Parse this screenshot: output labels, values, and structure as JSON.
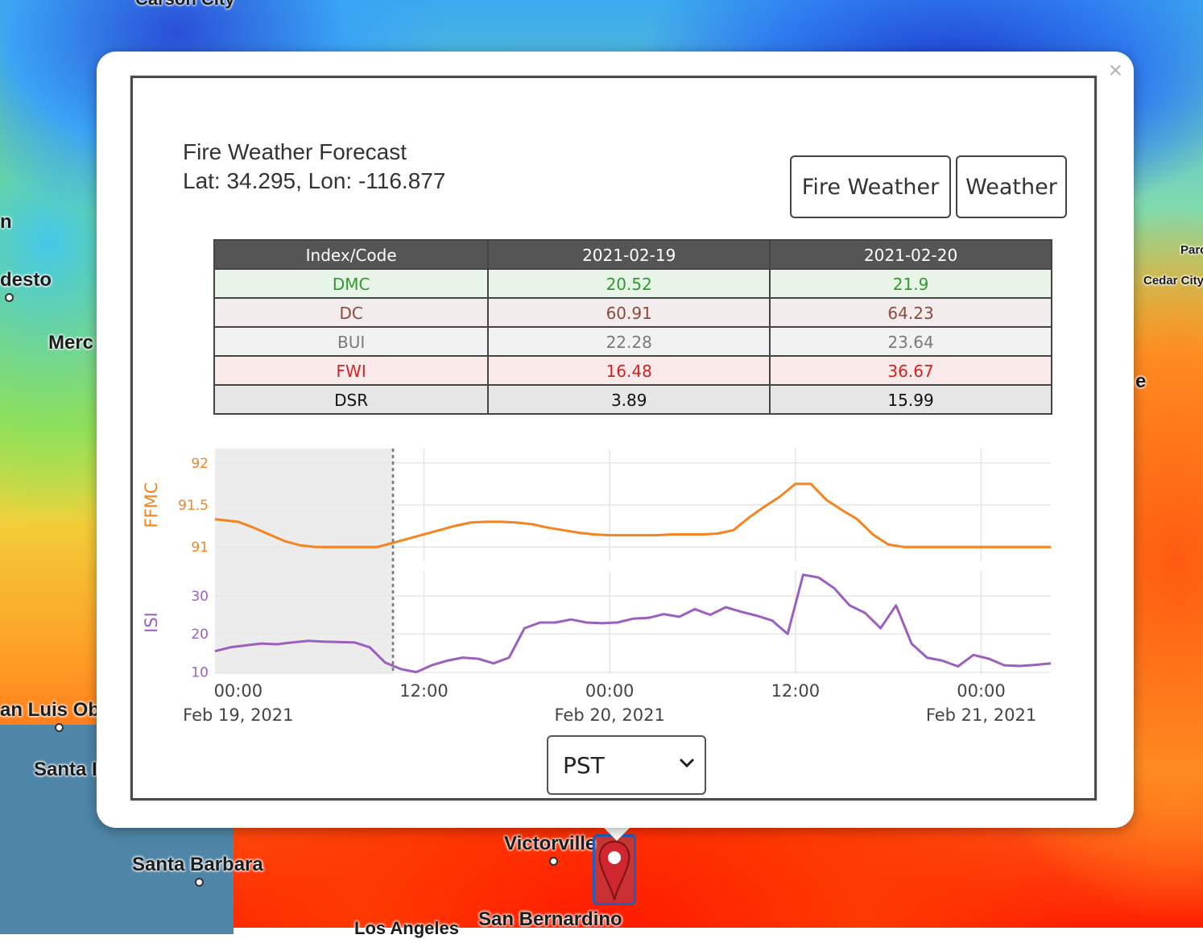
{
  "map": {
    "cities": [
      {
        "name": "Carson City"
      },
      {
        "name": "desto"
      },
      {
        "name": "Merc"
      },
      {
        "name": "an Luis Obi"
      },
      {
        "name": "Santa I"
      },
      {
        "name": "Santa Barbara"
      },
      {
        "name": "Victorville"
      },
      {
        "name": "San Bernardino"
      },
      {
        "name": "Los Angeles"
      },
      {
        "name": "Cedar City"
      },
      {
        "name": "Parc"
      },
      {
        "name": "e"
      },
      {
        "name": "n"
      }
    ]
  },
  "popup": {
    "close_label": "×",
    "title": "Fire Weather Forecast",
    "coords": "Lat: 34.295, Lon: -116.877",
    "buttons": {
      "fire_weather": "Fire Weather",
      "weather": "Weather"
    },
    "table": {
      "headers": [
        "Index/Code",
        "2021-02-19",
        "2021-02-20"
      ],
      "rows": [
        {
          "code": "DMC",
          "v1": "20.52",
          "v2": "21.9",
          "color": "#2e9a2e",
          "bg": "#e9f4e9"
        },
        {
          "code": "DC",
          "v1": "60.91",
          "v2": "64.23",
          "color": "#8b4a3c",
          "bg": "#f2ecec"
        },
        {
          "code": "BUI",
          "v1": "22.28",
          "v2": "23.64",
          "color": "#7a7a7a",
          "bg": "#f2f2f2"
        },
        {
          "code": "FWI",
          "v1": "16.48",
          "v2": "36.67",
          "color": "#d62020",
          "bg": "#fbeaea"
        },
        {
          "code": "DSR",
          "v1": "3.89",
          "v2": "15.99",
          "color": "#111111",
          "bg": "#e6e6e6"
        }
      ]
    },
    "timezone": {
      "selected": "PST"
    }
  },
  "chart_data": {
    "type": "line",
    "x_ticks": [
      {
        "line1": "00:00",
        "line2": "Feb 19, 2021"
      },
      {
        "line1": "12:00",
        "line2": ""
      },
      {
        "line1": "00:00",
        "line2": "Feb 20, 2021"
      },
      {
        "line1": "12:00",
        "line2": ""
      },
      {
        "line1": "00:00",
        "line2": "Feb 21, 2021"
      }
    ],
    "x_range_hours": [
      -1.5,
      52.5
    ],
    "now_hours": 10,
    "series": [
      {
        "name": "FFMC",
        "color": "#f58320",
        "ylim": [
          90.83,
          92.17
        ],
        "yticks": [
          "91",
          "91.5",
          "92"
        ],
        "points": [
          [
            -1.5,
            91.33
          ],
          [
            0,
            91.3
          ],
          [
            1,
            91.23
          ],
          [
            2,
            91.15
          ],
          [
            3,
            91.07
          ],
          [
            4,
            91.02
          ],
          [
            5,
            91.0
          ],
          [
            6,
            91.0
          ],
          [
            7,
            91.0
          ],
          [
            8,
            91.0
          ],
          [
            9,
            91.0
          ],
          [
            10,
            91.05
          ],
          [
            11,
            91.1
          ],
          [
            12,
            91.15
          ],
          [
            13,
            91.2
          ],
          [
            14,
            91.25
          ],
          [
            15,
            91.29
          ],
          [
            16,
            91.3
          ],
          [
            17,
            91.3
          ],
          [
            18,
            91.29
          ],
          [
            19,
            91.27
          ],
          [
            20,
            91.23
          ],
          [
            21,
            91.2
          ],
          [
            22,
            91.17
          ],
          [
            23,
            91.15
          ],
          [
            24,
            91.14
          ],
          [
            25,
            91.14
          ],
          [
            26,
            91.14
          ],
          [
            27,
            91.14
          ],
          [
            28,
            91.15
          ],
          [
            29,
            91.15
          ],
          [
            30,
            91.15
          ],
          [
            31,
            91.16
          ],
          [
            32,
            91.2
          ],
          [
            33,
            91.35
          ],
          [
            34,
            91.48
          ],
          [
            35,
            91.6
          ],
          [
            36,
            91.75
          ],
          [
            37,
            91.75
          ],
          [
            38,
            91.56
          ],
          [
            39,
            91.44
          ],
          [
            40,
            91.33
          ],
          [
            41,
            91.15
          ],
          [
            42,
            91.03
          ],
          [
            43,
            91.0
          ],
          [
            44,
            91.0
          ],
          [
            45,
            91.0
          ],
          [
            46,
            91.0
          ],
          [
            47,
            91.0
          ],
          [
            48,
            91.0
          ],
          [
            49,
            91.0
          ],
          [
            50,
            91.0
          ],
          [
            51,
            91.0
          ],
          [
            52,
            91.0
          ],
          [
            52.5,
            91.0
          ]
        ]
      },
      {
        "name": "ISI",
        "color": "#9b5fc0",
        "ylim": [
          9.5,
          36.5
        ],
        "yticks": [
          "10",
          "20",
          "30"
        ],
        "points": [
          [
            -1.5,
            15.5
          ],
          [
            -0.5,
            16.5
          ],
          [
            0.5,
            17
          ],
          [
            1.5,
            17.5
          ],
          [
            2.5,
            17.3
          ],
          [
            3.5,
            17.8
          ],
          [
            4.5,
            18.2
          ],
          [
            5.5,
            18.0
          ],
          [
            6.5,
            17.9
          ],
          [
            7.5,
            17.8
          ],
          [
            8.5,
            16.5
          ],
          [
            9.5,
            12.5
          ],
          [
            10.5,
            10.8
          ],
          [
            11.5,
            10.0
          ],
          [
            12.5,
            11.8
          ],
          [
            13.5,
            13.0
          ],
          [
            14.5,
            13.8
          ],
          [
            15.5,
            13.5
          ],
          [
            16.5,
            12.3
          ],
          [
            17.5,
            13.8
          ],
          [
            18.5,
            21.5
          ],
          [
            19.5,
            23.0
          ],
          [
            20.5,
            23.0
          ],
          [
            21.5,
            23.8
          ],
          [
            22.5,
            23.0
          ],
          [
            23.5,
            22.8
          ],
          [
            24.5,
            23.0
          ],
          [
            25.5,
            24.0
          ],
          [
            26.5,
            24.2
          ],
          [
            27.5,
            25.2
          ],
          [
            28.5,
            24.5
          ],
          [
            29.5,
            26.5
          ],
          [
            30.5,
            25.0
          ],
          [
            31.5,
            27.0
          ],
          [
            32.5,
            25.8
          ],
          [
            33.5,
            24.8
          ],
          [
            34.5,
            23.5
          ],
          [
            35.5,
            20.0
          ],
          [
            36.5,
            35.5
          ],
          [
            37.5,
            34.8
          ],
          [
            38.5,
            32.0
          ],
          [
            39.5,
            27.5
          ],
          [
            40.5,
            25.5
          ],
          [
            41.5,
            21.5
          ],
          [
            42.5,
            27.5
          ],
          [
            43.5,
            17.5
          ],
          [
            44.5,
            13.8
          ],
          [
            45.5,
            13.0
          ],
          [
            46.5,
            11.5
          ],
          [
            47.5,
            14.5
          ],
          [
            48.5,
            13.5
          ],
          [
            49.5,
            11.8
          ],
          [
            50.5,
            11.6
          ],
          [
            51.5,
            11.9
          ],
          [
            52.5,
            12.3
          ]
        ]
      }
    ]
  }
}
